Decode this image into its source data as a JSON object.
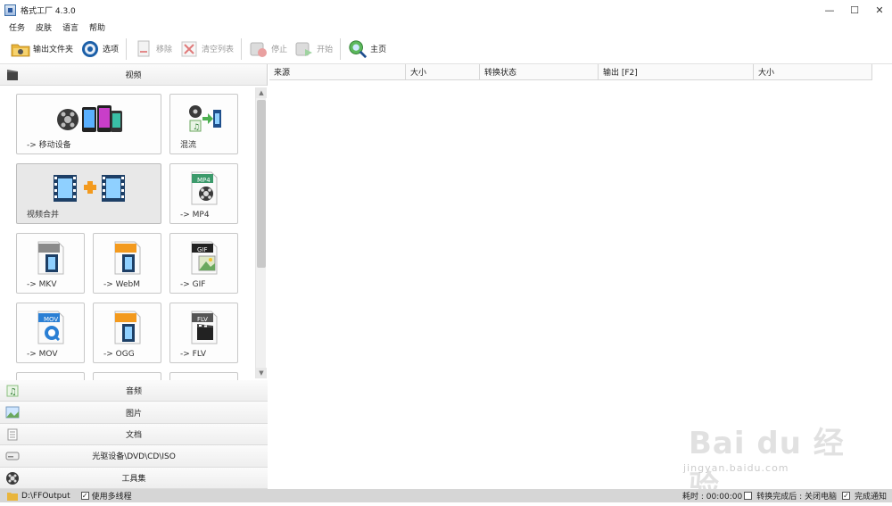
{
  "window": {
    "title": "格式工厂 4.3.0",
    "controls": [
      "—",
      "☐",
      "✕"
    ]
  },
  "menu": [
    "任务",
    "皮肤",
    "语言",
    "帮助"
  ],
  "toolbar": {
    "output_folder": "输出文件夹",
    "options": "选项",
    "remove": "移除",
    "clear_list": "清空列表",
    "stop": "停止",
    "start": "开始",
    "home": "主页"
  },
  "sidebar": {
    "video_header": "视频",
    "tiles": [
      {
        "label": "-> 移动设备"
      },
      {
        "label": "混流"
      },
      {
        "label": "视频合并"
      },
      {
        "label": "-> MP4"
      },
      {
        "label": "-> MKV"
      },
      {
        "label": "-> WebM"
      },
      {
        "label": "-> GIF"
      },
      {
        "label": "-> MOV"
      },
      {
        "label": "-> OGG"
      },
      {
        "label": "-> FLV"
      }
    ],
    "format_badges": {
      "mp4": "MP4",
      "gif": "GIF",
      "mov": "MOV",
      "flv": "FLV"
    },
    "categories": [
      "音频",
      "图片",
      "文档",
      "光驱设备\\DVD\\CD\\ISO",
      "工具集"
    ]
  },
  "table": {
    "columns": [
      "来源",
      "大小",
      "转换状态",
      "输出 [F2]",
      "大小"
    ]
  },
  "statusbar": {
    "output_path": "D:\\FFOutput",
    "multithread_label": "使用多线程",
    "multithread_checked": true,
    "elapsed_label": "耗时 : 00:00:00",
    "after_convert_label": "转换完成后 : 关闭电脑",
    "after_convert_checked": false,
    "notify_label": "完成通知",
    "notify_checked": true
  },
  "watermark": {
    "logo": "Bai du 经验",
    "url": "jingyan.baidu.com"
  },
  "colors": {
    "accent_blue": "#2a7fd4",
    "orange": "#f39a1e",
    "statusbar_bg": "#d6d6d6"
  }
}
